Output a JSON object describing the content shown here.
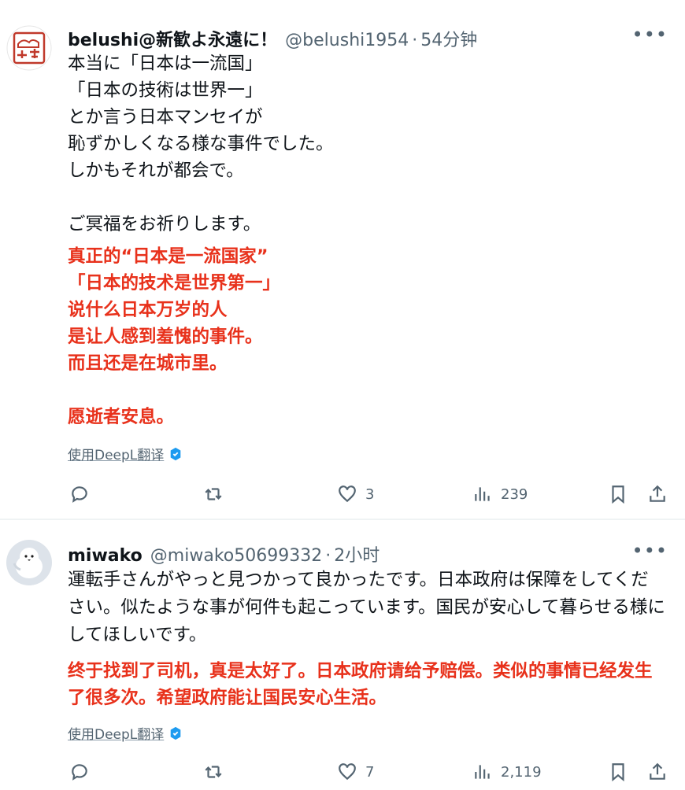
{
  "tweets": [
    {
      "name": "belushi@新歓よ永遠に！",
      "handle": "@belushi1954",
      "separator": "·",
      "time": "54分钟",
      "more": "•••",
      "text_jp": "本当に「日本は一流国」\n「日本の技術は世界一」\nとか言う日本マンセイが\n恥ずかしくなる様な事件でした。\nしかもそれが都会で。\n\nご冥福をお祈りします。",
      "text_cn": "真正的“日本是一流国家”\n「日本的技术是世界第一」\n说什么日本万岁的人\n是让人感到羞愧的事件。\n而且还是在城市里。\n\n愿逝者安息。",
      "translate_label": "使用DeepL翻译",
      "actions": {
        "reply": "",
        "retweet": "",
        "like": "3",
        "views": "239"
      }
    },
    {
      "name": "miwako",
      "handle": "@miwako50699332",
      "separator": "·",
      "time": "2小时",
      "more": "•••",
      "text_jp": "運転手さんがやっと見つかって良かったです。日本政府は保障をしてください。似たような事が何件も起こっています。国民が安心して暮らせる様にしてほしいです。",
      "text_cn": "终于找到了司机，真是太好了。日本政府请给予赔偿。类似的事情已经发生了很多次。希望政府能让国民安心生活。",
      "translate_label": "使用DeepL翻译",
      "actions": {
        "reply": "",
        "retweet": "",
        "like": "7",
        "views": "2,119"
      }
    }
  ],
  "colors": {
    "text": "#0f1419",
    "secondary": "#536471",
    "translation_red": "#e8311b",
    "badge_blue": "#1d9bf0"
  },
  "icons": [
    "more-icon",
    "reply-icon",
    "retweet-icon",
    "like-icon",
    "views-icon",
    "bookmark-icon",
    "share-icon",
    "deepl-badge-icon"
  ]
}
